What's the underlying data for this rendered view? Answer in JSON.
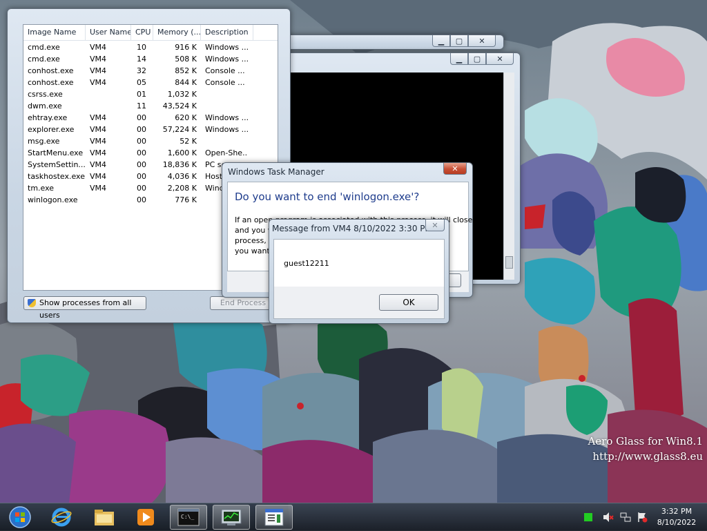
{
  "taskmanager": {
    "columns": [
      "Image Name",
      "User Name",
      "CPU",
      "Memory (...",
      "Description"
    ],
    "rows": [
      {
        "name": "cmd.exe",
        "user": "VM4",
        "cpu": "10",
        "mem": "916 K",
        "desc": "Windows ..."
      },
      {
        "name": "cmd.exe",
        "user": "VM4",
        "cpu": "14",
        "mem": "508 K",
        "desc": "Windows ..."
      },
      {
        "name": "conhost.exe",
        "user": "VM4",
        "cpu": "32",
        "mem": "852 K",
        "desc": "Console ..."
      },
      {
        "name": "conhost.exe",
        "user": "VM4",
        "cpu": "05",
        "mem": "844 K",
        "desc": "Console ..."
      },
      {
        "name": "csrss.exe",
        "user": "",
        "cpu": "01",
        "mem": "1,032 K",
        "desc": ""
      },
      {
        "name": "dwm.exe",
        "user": "",
        "cpu": "11",
        "mem": "43,524 K",
        "desc": ""
      },
      {
        "name": "ehtray.exe",
        "user": "VM4",
        "cpu": "00",
        "mem": "620 K",
        "desc": "Windows ..."
      },
      {
        "name": "explorer.exe",
        "user": "VM4",
        "cpu": "00",
        "mem": "57,224 K",
        "desc": "Windows ..."
      },
      {
        "name": "msg.exe",
        "user": "VM4",
        "cpu": "00",
        "mem": "52 K",
        "desc": ""
      },
      {
        "name": "StartMenu.exe",
        "user": "VM4",
        "cpu": "00",
        "mem": "1,600 K",
        "desc": "Open-She..."
      },
      {
        "name": "SystemSettin...",
        "user": "VM4",
        "cpu": "00",
        "mem": "18,836 K",
        "desc": "PC se"
      },
      {
        "name": "taskhostex.exe",
        "user": "VM4",
        "cpu": "00",
        "mem": "4,036 K",
        "desc": "Host"
      },
      {
        "name": "tm.exe",
        "user": "VM4",
        "cpu": "00",
        "mem": "2,208 K",
        "desc": "Wind"
      },
      {
        "name": "winlogon.exe",
        "user": "",
        "cpu": "00",
        "mem": "776 K",
        "desc": ""
      }
    ],
    "show_all_label": "Show processes from all users",
    "end_process_label": "End Process"
  },
  "confirm": {
    "title": "Windows Task Manager",
    "heading": "Do you want to end 'winlogon.exe'?",
    "body_lines": [
      "If an open program is associated with this process, it will close",
      "and you w",
      "process, i",
      "you want"
    ]
  },
  "message": {
    "title": "Message from VM4 8/10/2022 3:30 PM",
    "text": "guest12211",
    "ok_label": "OK"
  },
  "watermark": {
    "line1": "Aero Glass for Win8.1",
    "line2": "http://www.glass8.eu"
  },
  "clock": {
    "time": "3:32 PM",
    "date": "8/10/2022"
  },
  "caption": {
    "minimize": "▁",
    "maximize": "▢",
    "close": "✕"
  },
  "icons": {
    "taskbar": [
      "start-orb-icon",
      "internet-explorer-icon",
      "file-explorer-icon",
      "media-player-icon",
      "command-prompt-icon",
      "task-manager-icon",
      "message-window-icon"
    ],
    "tray": [
      "green-status-icon",
      "speaker-muted-icon",
      "network-icon",
      "action-center-flag-icon"
    ]
  },
  "colors": {
    "accent": "#1e4f9c",
    "close": "#c75036",
    "heading": "#1e3c8c"
  }
}
